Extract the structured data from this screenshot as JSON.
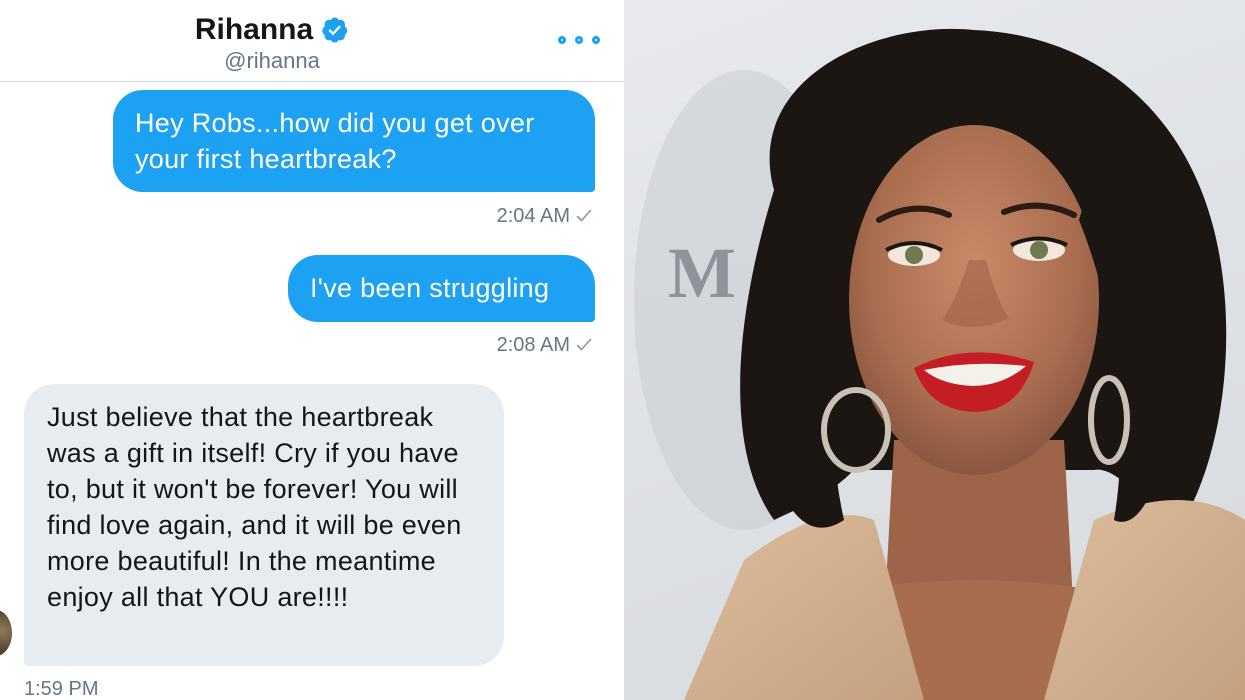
{
  "conversation": {
    "display_name": "Rihanna",
    "handle": "@rihanna",
    "verified": true,
    "verified_icon": "verified-badge-icon",
    "more_icon": "more-options-icon"
  },
  "messages": [
    {
      "direction": "sent",
      "text": "Hey Robs...how did you get over your first heartbreak?",
      "time": "2:04 AM"
    },
    {
      "direction": "sent",
      "text": "I've been struggling",
      "time": "2:08 AM"
    },
    {
      "direction": "received",
      "text": "Just believe that the heartbreak was a gift in itself! Cry if you have to, but it won't be forever! You will find love again, and it will be even more beautiful! In the meantime enjoy all that YOU are!!!!",
      "time": "1:59 PM"
    }
  ],
  "photo": {
    "backdrop_text": "M",
    "colors": {
      "backdrop": "#e3e5e8",
      "hair": "#1c1613",
      "skin": "#b4785a",
      "lips": "#c41e24",
      "coat": "#d2b291"
    }
  },
  "colors": {
    "accent": "#1da1f2",
    "received_bubble": "#e6ecf0",
    "muted_text": "#657786",
    "primary_text": "#14171a"
  }
}
